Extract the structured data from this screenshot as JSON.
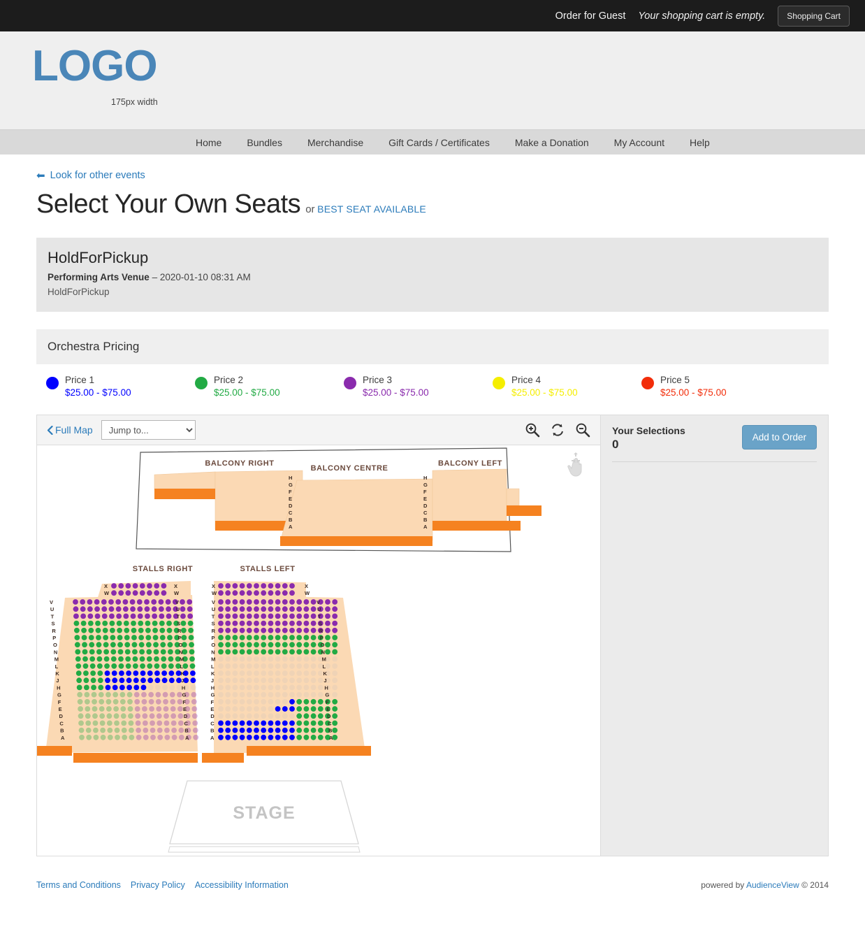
{
  "topbar": {
    "order_for": "Order for Guest",
    "cart_status": "Your shopping cart is empty.",
    "cart_button": "Shopping Cart"
  },
  "branding": {
    "logo_text": "LOGO",
    "logo_caption": "175px width",
    "logo_color": "#4a86b8"
  },
  "nav": {
    "items": [
      {
        "label": "Home"
      },
      {
        "label": "Bundles"
      },
      {
        "label": "Merchandise"
      },
      {
        "label": "Gift Cards / Certificates"
      },
      {
        "label": "Make a Donation"
      },
      {
        "label": "My Account"
      },
      {
        "label": "Help"
      }
    ]
  },
  "page": {
    "back_link": "Look for other events",
    "title": "Select Your Own Seats",
    "title_or": "or",
    "best_seat_link": "BEST SEAT AVAILABLE"
  },
  "event": {
    "name": "HoldForPickup",
    "venue": "Performing Arts Venue",
    "dash": "–",
    "datetime": "2020-01-10 08:31 AM",
    "subtitle": "HoldForPickup"
  },
  "pricing": {
    "header": "Orchestra Pricing",
    "legend": [
      {
        "label": "Price 1",
        "range": "$25.00 - $75.00",
        "color": "#0000ff"
      },
      {
        "label": "Price 2",
        "range": "$25.00 - $75.00",
        "color": "#22aa44"
      },
      {
        "label": "Price 3",
        "range": "$25.00 - $75.00",
        "color": "#8a2bad"
      },
      {
        "label": "Price 4",
        "range": "$25.00 - $75.00",
        "color": "#f5ee00"
      },
      {
        "label": "Price 5",
        "range": "$25.00 - $75.00",
        "color": "#f22d0a"
      }
    ]
  },
  "map_toolbar": {
    "full_map": "Full Map",
    "jump_to_value": "Jump to...",
    "jump_to_options": [
      "Jump to..."
    ],
    "zoom_in_icon": "zoom-in-icon",
    "reset_icon": "reset-icon",
    "zoom_out_icon": "zoom-out-icon",
    "pan_cursor_icon": "pan-hand-icon"
  },
  "seatmap": {
    "sections": [
      {
        "name": "BALCONY RIGHT"
      },
      {
        "name": "BALCONY CENTRE"
      },
      {
        "name": "BALCONY LEFT"
      },
      {
        "name": "STALLS RIGHT"
      },
      {
        "name": "STALLS LEFT"
      }
    ],
    "stage_label": "STAGE",
    "balcony_rows": [
      "H",
      "G",
      "F",
      "E",
      "D",
      "C",
      "B",
      "A"
    ],
    "stalls_rows_upper": [
      "X",
      "W"
    ],
    "stalls_rows_main": [
      "V",
      "U",
      "T",
      "S",
      "R",
      "P",
      "O",
      "N",
      "M",
      "L",
      "K",
      "J",
      "H",
      "G",
      "F",
      "E",
      "D",
      "C",
      "B",
      "A"
    ],
    "seat_colors": {
      "price1": "#0000ff",
      "price2": "#22aa44",
      "price3": "#8a2bad",
      "available_dim": "#d9c8bb",
      "section_fill": "#fbd9b4",
      "section_fill_light": "#fde3c7",
      "aisle_bar": "#f58220"
    }
  },
  "selections": {
    "title": "Your Selections",
    "count": "0",
    "add_button": "Add to Order"
  },
  "footer": {
    "links": [
      {
        "label": "Terms and Conditions"
      },
      {
        "label": "Privacy Policy"
      },
      {
        "label": "Accessibility Information"
      }
    ],
    "powered_prefix": "powered by ",
    "powered_brand": "AudienceView",
    "powered_suffix": " © 2014"
  }
}
